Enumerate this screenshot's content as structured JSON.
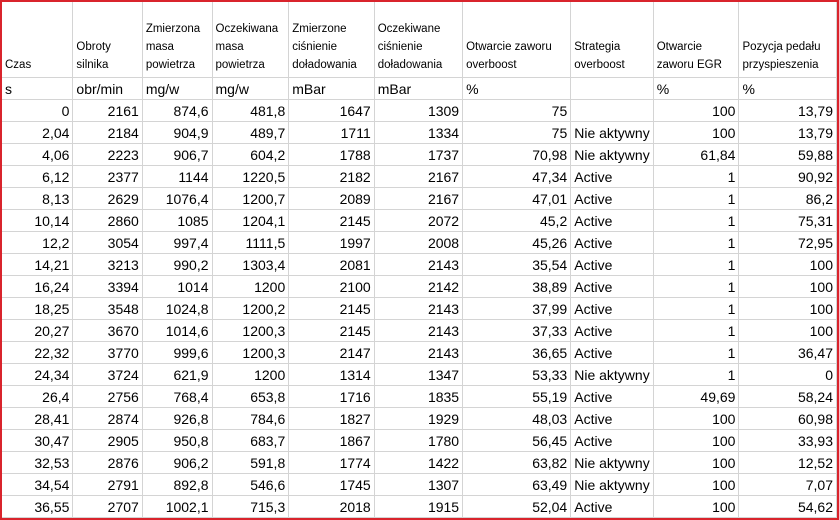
{
  "headers": [
    "Czas",
    "Obroty silnika",
    "Zmierzona masa powietrza",
    "Oczekiwana masa powietrza",
    "Zmierzone ciśnienie doładowania",
    "Oczekiwane ciśnienie doładowania",
    "Otwarcie zaworu overboost",
    "Strategia overboost",
    "Otwarcie zaworu EGR",
    "Pozycja pedału przyspieszenia"
  ],
  "units": [
    "s",
    "obr/min",
    "mg/w",
    "mg/w",
    "mBar",
    "mBar",
    "%",
    "",
    "%",
    "%"
  ],
  "rows": [
    [
      "0",
      "2161",
      "874,6",
      "481,8",
      "1647",
      "1309",
      "75",
      "",
      "100",
      "13,79"
    ],
    [
      "2,04",
      "2184",
      "904,9",
      "489,7",
      "1711",
      "1334",
      "75",
      "Nie aktywny",
      "100",
      "13,79"
    ],
    [
      "4,06",
      "2223",
      "906,7",
      "604,2",
      "1788",
      "1737",
      "70,98",
      "Nie aktywny",
      "61,84",
      "59,88"
    ],
    [
      "6,12",
      "2377",
      "1144",
      "1220,5",
      "2182",
      "2167",
      "47,34",
      "Active",
      "1",
      "90,92"
    ],
    [
      "8,13",
      "2629",
      "1076,4",
      "1200,7",
      "2089",
      "2167",
      "47,01",
      "Active",
      "1",
      "86,2"
    ],
    [
      "10,14",
      "2860",
      "1085",
      "1204,1",
      "2145",
      "2072",
      "45,2",
      "Active",
      "1",
      "75,31"
    ],
    [
      "12,2",
      "3054",
      "997,4",
      "1111,5",
      "1997",
      "2008",
      "45,26",
      "Active",
      "1",
      "72,95"
    ],
    [
      "14,21",
      "3213",
      "990,2",
      "1303,4",
      "2081",
      "2143",
      "35,54",
      "Active",
      "1",
      "100"
    ],
    [
      "16,24",
      "3394",
      "1014",
      "1200",
      "2100",
      "2142",
      "38,89",
      "Active",
      "1",
      "100"
    ],
    [
      "18,25",
      "3548",
      "1024,8",
      "1200,2",
      "2145",
      "2143",
      "37,99",
      "Active",
      "1",
      "100"
    ],
    [
      "20,27",
      "3670",
      "1014,6",
      "1200,3",
      "2145",
      "2143",
      "37,33",
      "Active",
      "1",
      "100"
    ],
    [
      "22,32",
      "3770",
      "999,6",
      "1200,3",
      "2147",
      "2143",
      "36,65",
      "Active",
      "1",
      "36,47"
    ],
    [
      "24,34",
      "3724",
      "621,9",
      "1200",
      "1314",
      "1347",
      "53,33",
      "Nie aktywny",
      "1",
      "0"
    ],
    [
      "26,4",
      "2756",
      "768,4",
      "653,8",
      "1716",
      "1835",
      "55,19",
      "Active",
      "49,69",
      "58,24"
    ],
    [
      "28,41",
      "2874",
      "926,8",
      "784,6",
      "1827",
      "1929",
      "48,03",
      "Active",
      "100",
      "60,98"
    ],
    [
      "30,47",
      "2905",
      "950,8",
      "683,7",
      "1867",
      "1780",
      "56,45",
      "Active",
      "100",
      "33,93"
    ],
    [
      "32,53",
      "2876",
      "906,2",
      "591,8",
      "1774",
      "1422",
      "63,82",
      "Nie aktywny",
      "100",
      "12,52"
    ],
    [
      "34,54",
      "2791",
      "892,8",
      "546,6",
      "1745",
      "1307",
      "63,49",
      "Nie aktywny",
      "100",
      "7,07"
    ],
    [
      "36,55",
      "2707",
      "1002,1",
      "715,3",
      "2018",
      "1915",
      "52,04",
      "Active",
      "100",
      "54,62"
    ]
  ]
}
